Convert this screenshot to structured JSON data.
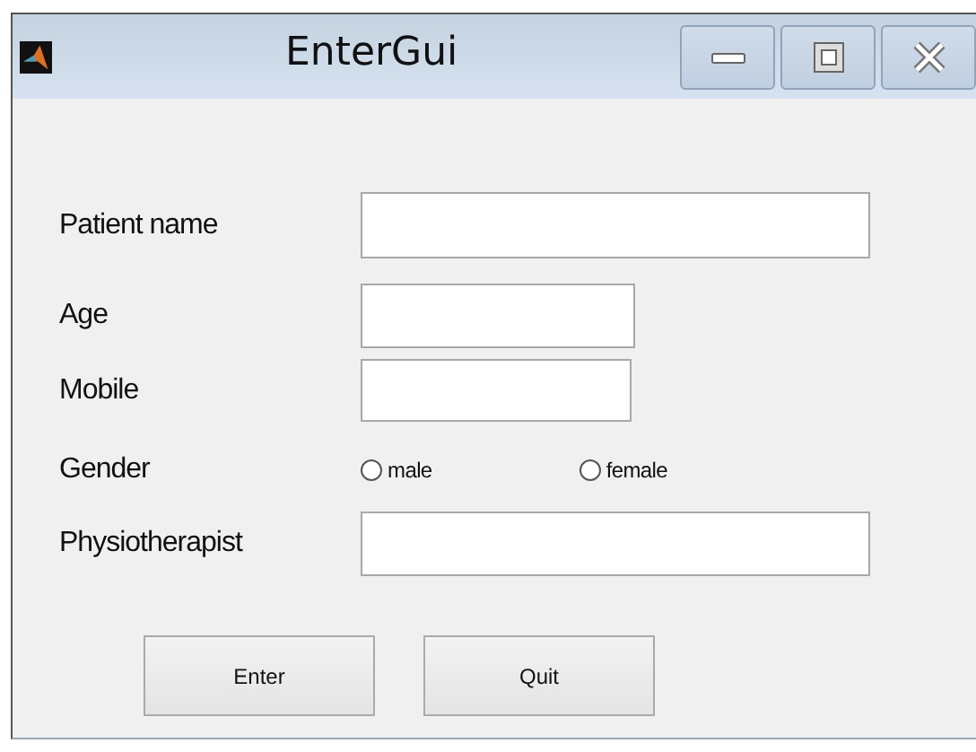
{
  "window": {
    "title": "EnterGui"
  },
  "fields": [
    {
      "kind": "text",
      "label": "Patient name"
    },
    {
      "kind": "text",
      "label": "Age"
    },
    {
      "kind": "text",
      "label": "Mobile"
    },
    {
      "kind": "radio",
      "label": "Gender",
      "options": [
        {
          "label": "male",
          "selected": false
        },
        {
          "label": "female",
          "selected": false
        }
      ]
    },
    {
      "kind": "text",
      "label": "Physiotherapist"
    }
  ],
  "buttons": [
    "Enter",
    "Quit"
  ]
}
